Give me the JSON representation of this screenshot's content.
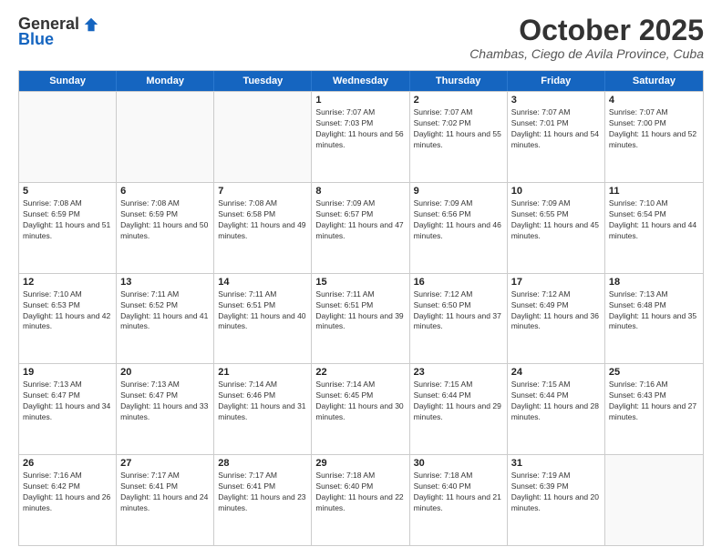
{
  "logo": {
    "general": "General",
    "blue": "Blue"
  },
  "header": {
    "month": "October 2025",
    "location": "Chambas, Ciego de Avila Province, Cuba"
  },
  "days_of_week": [
    "Sunday",
    "Monday",
    "Tuesday",
    "Wednesday",
    "Thursday",
    "Friday",
    "Saturday"
  ],
  "weeks": [
    [
      {
        "day": "",
        "info": ""
      },
      {
        "day": "",
        "info": ""
      },
      {
        "day": "",
        "info": ""
      },
      {
        "day": "1",
        "info": "Sunrise: 7:07 AM\nSunset: 7:03 PM\nDaylight: 11 hours and 56 minutes."
      },
      {
        "day": "2",
        "info": "Sunrise: 7:07 AM\nSunset: 7:02 PM\nDaylight: 11 hours and 55 minutes."
      },
      {
        "day": "3",
        "info": "Sunrise: 7:07 AM\nSunset: 7:01 PM\nDaylight: 11 hours and 54 minutes."
      },
      {
        "day": "4",
        "info": "Sunrise: 7:07 AM\nSunset: 7:00 PM\nDaylight: 11 hours and 52 minutes."
      }
    ],
    [
      {
        "day": "5",
        "info": "Sunrise: 7:08 AM\nSunset: 6:59 PM\nDaylight: 11 hours and 51 minutes."
      },
      {
        "day": "6",
        "info": "Sunrise: 7:08 AM\nSunset: 6:59 PM\nDaylight: 11 hours and 50 minutes."
      },
      {
        "day": "7",
        "info": "Sunrise: 7:08 AM\nSunset: 6:58 PM\nDaylight: 11 hours and 49 minutes."
      },
      {
        "day": "8",
        "info": "Sunrise: 7:09 AM\nSunset: 6:57 PM\nDaylight: 11 hours and 47 minutes."
      },
      {
        "day": "9",
        "info": "Sunrise: 7:09 AM\nSunset: 6:56 PM\nDaylight: 11 hours and 46 minutes."
      },
      {
        "day": "10",
        "info": "Sunrise: 7:09 AM\nSunset: 6:55 PM\nDaylight: 11 hours and 45 minutes."
      },
      {
        "day": "11",
        "info": "Sunrise: 7:10 AM\nSunset: 6:54 PM\nDaylight: 11 hours and 44 minutes."
      }
    ],
    [
      {
        "day": "12",
        "info": "Sunrise: 7:10 AM\nSunset: 6:53 PM\nDaylight: 11 hours and 42 minutes."
      },
      {
        "day": "13",
        "info": "Sunrise: 7:11 AM\nSunset: 6:52 PM\nDaylight: 11 hours and 41 minutes."
      },
      {
        "day": "14",
        "info": "Sunrise: 7:11 AM\nSunset: 6:51 PM\nDaylight: 11 hours and 40 minutes."
      },
      {
        "day": "15",
        "info": "Sunrise: 7:11 AM\nSunset: 6:51 PM\nDaylight: 11 hours and 39 minutes."
      },
      {
        "day": "16",
        "info": "Sunrise: 7:12 AM\nSunset: 6:50 PM\nDaylight: 11 hours and 37 minutes."
      },
      {
        "day": "17",
        "info": "Sunrise: 7:12 AM\nSunset: 6:49 PM\nDaylight: 11 hours and 36 minutes."
      },
      {
        "day": "18",
        "info": "Sunrise: 7:13 AM\nSunset: 6:48 PM\nDaylight: 11 hours and 35 minutes."
      }
    ],
    [
      {
        "day": "19",
        "info": "Sunrise: 7:13 AM\nSunset: 6:47 PM\nDaylight: 11 hours and 34 minutes."
      },
      {
        "day": "20",
        "info": "Sunrise: 7:13 AM\nSunset: 6:47 PM\nDaylight: 11 hours and 33 minutes."
      },
      {
        "day": "21",
        "info": "Sunrise: 7:14 AM\nSunset: 6:46 PM\nDaylight: 11 hours and 31 minutes."
      },
      {
        "day": "22",
        "info": "Sunrise: 7:14 AM\nSunset: 6:45 PM\nDaylight: 11 hours and 30 minutes."
      },
      {
        "day": "23",
        "info": "Sunrise: 7:15 AM\nSunset: 6:44 PM\nDaylight: 11 hours and 29 minutes."
      },
      {
        "day": "24",
        "info": "Sunrise: 7:15 AM\nSunset: 6:44 PM\nDaylight: 11 hours and 28 minutes."
      },
      {
        "day": "25",
        "info": "Sunrise: 7:16 AM\nSunset: 6:43 PM\nDaylight: 11 hours and 27 minutes."
      }
    ],
    [
      {
        "day": "26",
        "info": "Sunrise: 7:16 AM\nSunset: 6:42 PM\nDaylight: 11 hours and 26 minutes."
      },
      {
        "day": "27",
        "info": "Sunrise: 7:17 AM\nSunset: 6:41 PM\nDaylight: 11 hours and 24 minutes."
      },
      {
        "day": "28",
        "info": "Sunrise: 7:17 AM\nSunset: 6:41 PM\nDaylight: 11 hours and 23 minutes."
      },
      {
        "day": "29",
        "info": "Sunrise: 7:18 AM\nSunset: 6:40 PM\nDaylight: 11 hours and 22 minutes."
      },
      {
        "day": "30",
        "info": "Sunrise: 7:18 AM\nSunset: 6:40 PM\nDaylight: 11 hours and 21 minutes."
      },
      {
        "day": "31",
        "info": "Sunrise: 7:19 AM\nSunset: 6:39 PM\nDaylight: 11 hours and 20 minutes."
      },
      {
        "day": "",
        "info": ""
      }
    ]
  ]
}
